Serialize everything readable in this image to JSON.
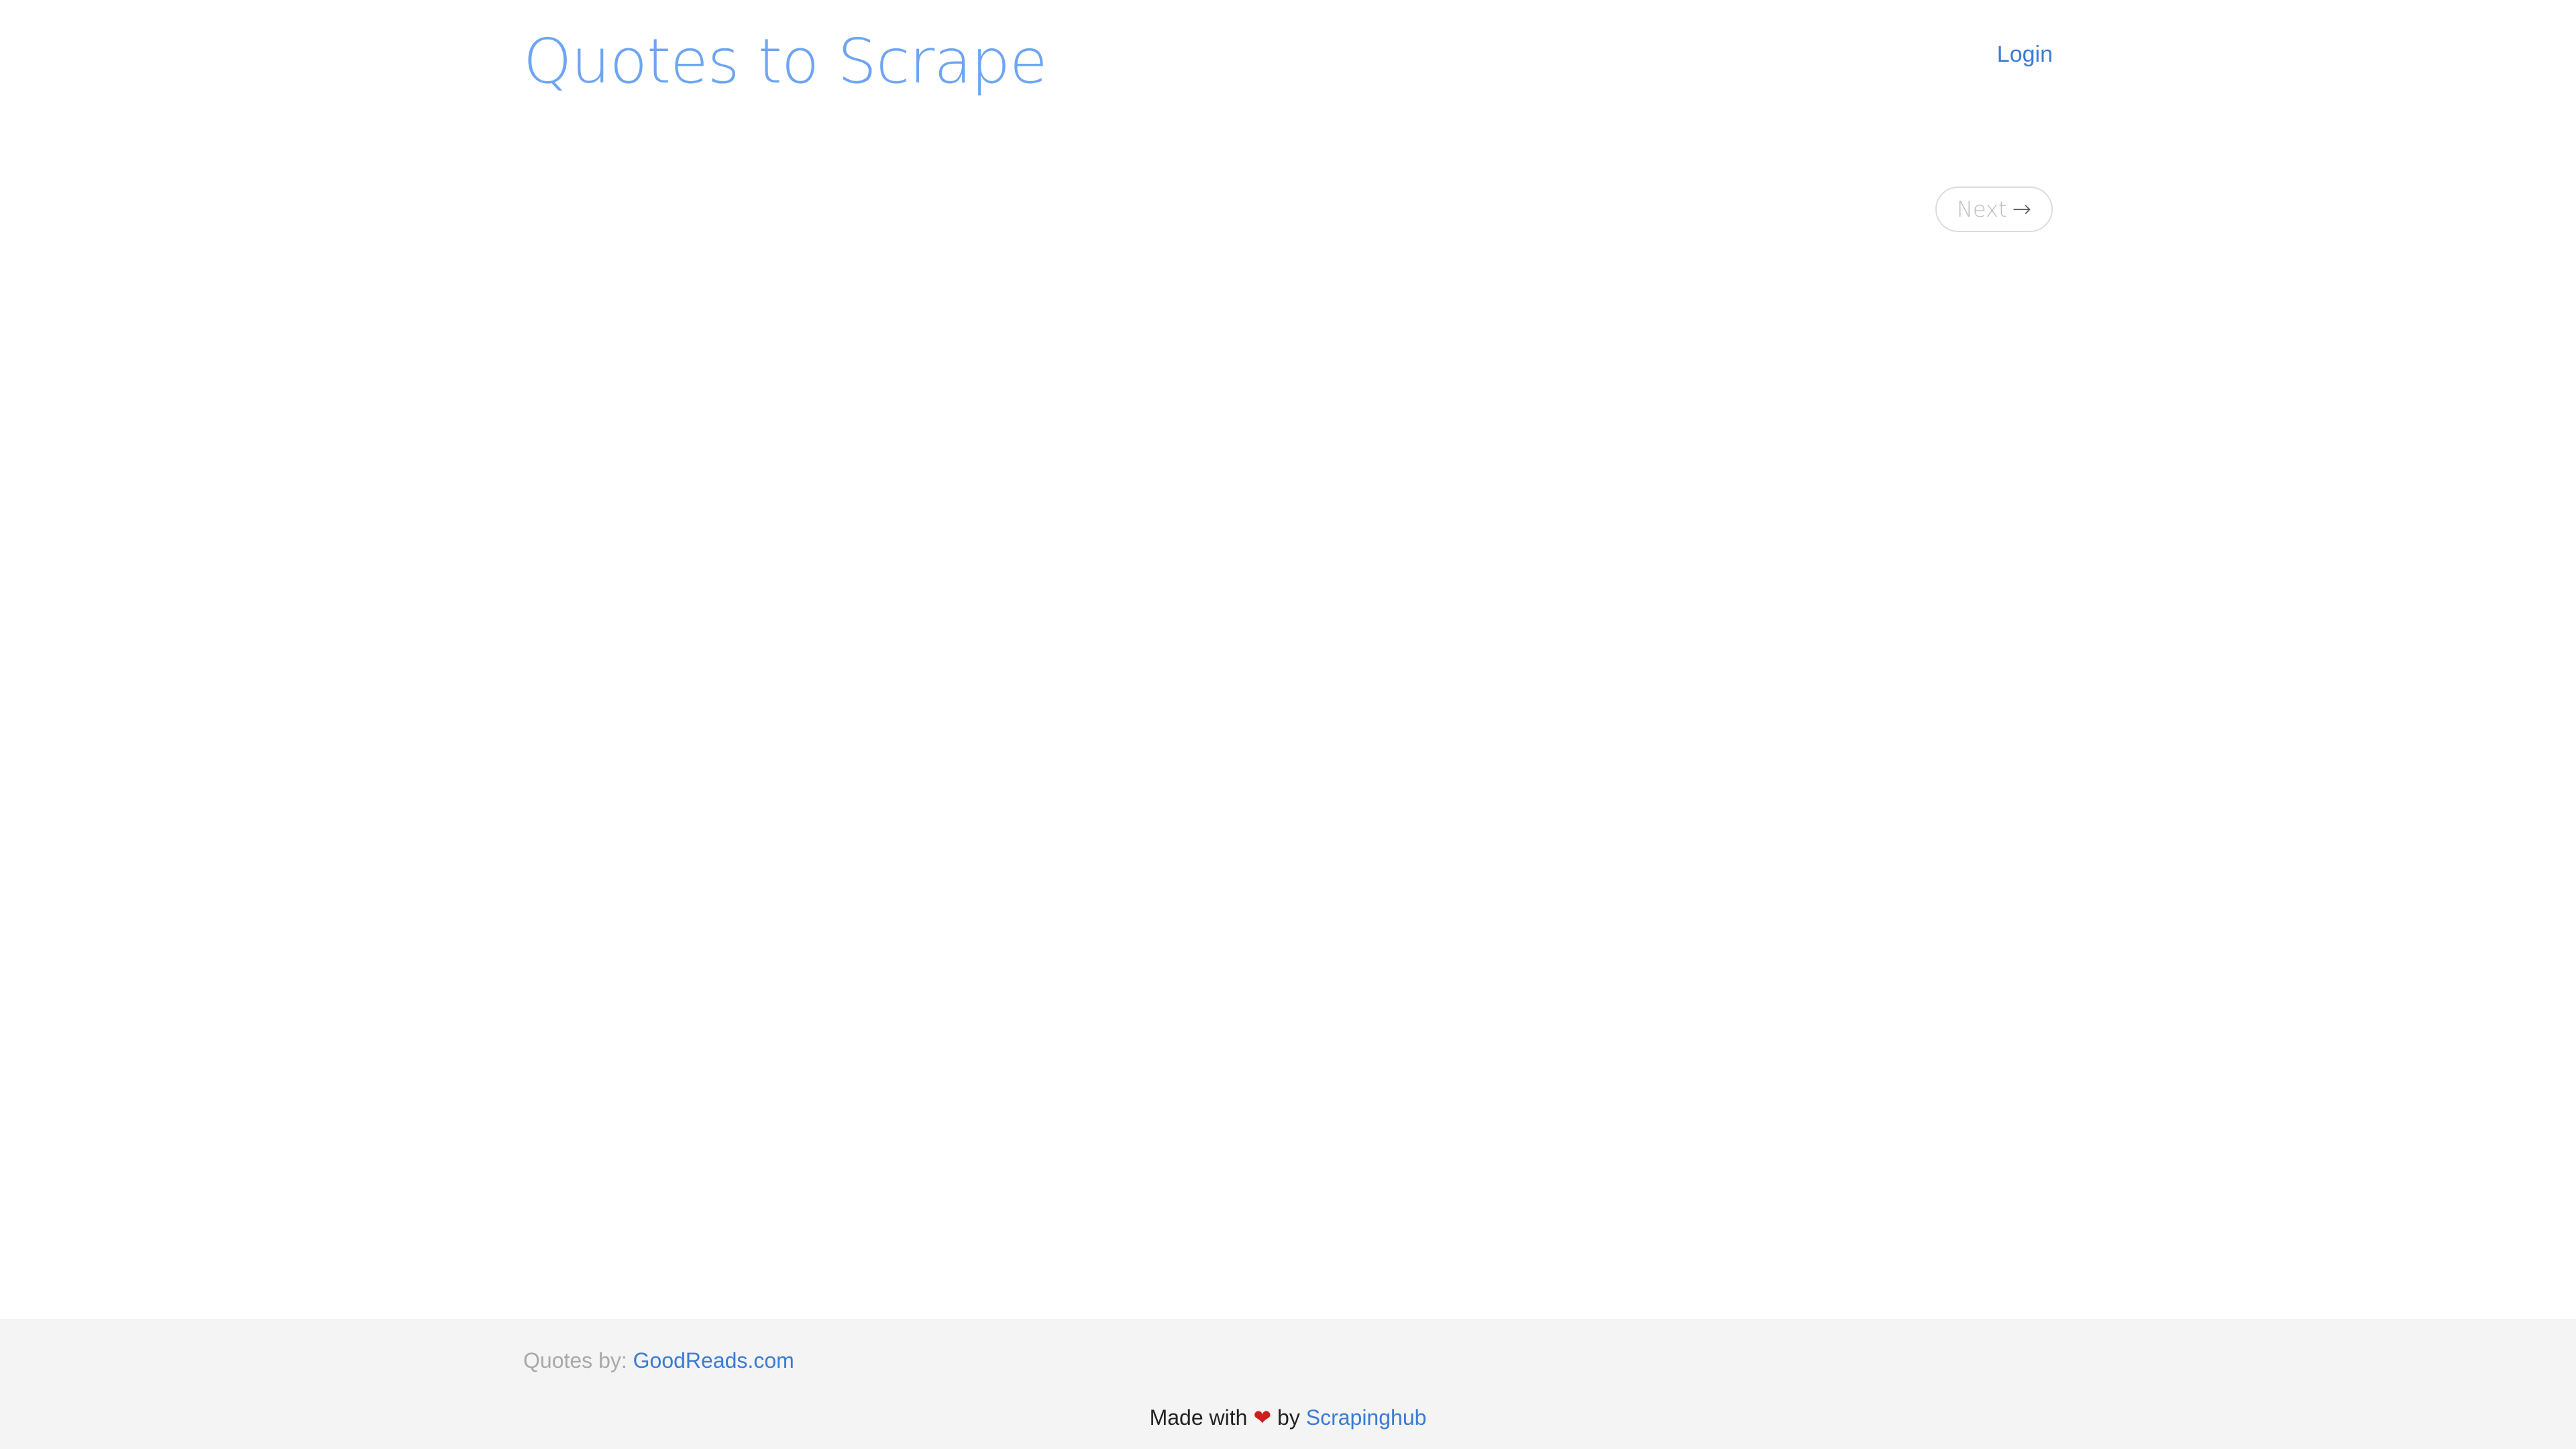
{
  "header": {
    "title": "Quotes to Scrape",
    "login_label": "Login"
  },
  "pager": {
    "next_label": "Next",
    "next_arrow": "→"
  },
  "footer": {
    "credit_prefix": "Quotes by:",
    "credit_link": "GoodReads.com",
    "made_with": "Made with",
    "heart": "❤",
    "by": "by",
    "made_link": "Scrapinghub"
  },
  "colors": {
    "title": "#6ea5f2",
    "link": "#3a7bd5",
    "heart": "#cc1f1f",
    "footer_bg": "#f4f4f4"
  }
}
